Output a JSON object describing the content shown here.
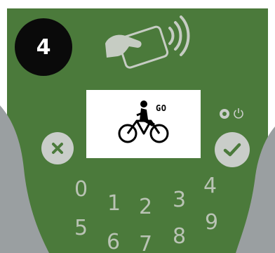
{
  "colors": {
    "panel_green": "#4b7a3b",
    "side_gray": "#9a9fa1",
    "key_text": "#b9c3b4",
    "button_gray": "#c9cdc9",
    "badge_black": "#0a0a0a"
  },
  "step": {
    "number": "4"
  },
  "contactless_icon": "hand-card-nfc-icon",
  "screen": {
    "icon": "cyclist-icon",
    "label": "GO"
  },
  "buttons": {
    "cancel_icon": "close-icon",
    "confirm_icon": "check-icon",
    "power_icon": "power-icon"
  },
  "keypad": {
    "keys": [
      "0",
      "1",
      "2",
      "3",
      "4",
      "5",
      "6",
      "7",
      "8",
      "9"
    ]
  }
}
